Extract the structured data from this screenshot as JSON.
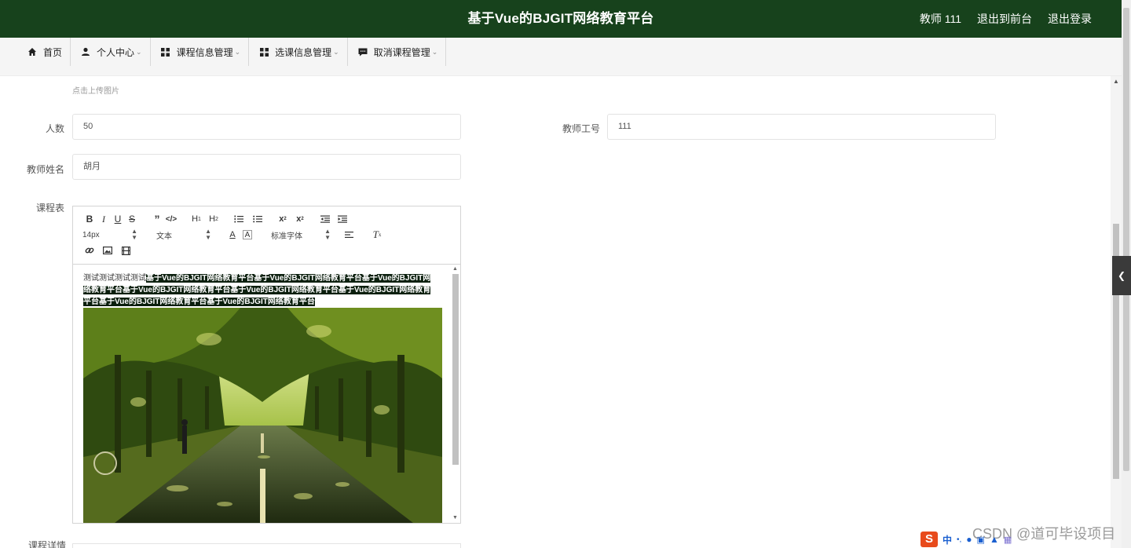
{
  "header": {
    "title": "基于Vue的BJGIT网络教育平台",
    "user_label": "教师 111",
    "back_front_label": "退出到前台",
    "logout_label": "退出登录"
  },
  "nav": {
    "items": [
      {
        "label": "首页",
        "icon": "home-icon",
        "has_dropdown": false
      },
      {
        "label": "个人中心",
        "icon": "user-icon",
        "has_dropdown": true
      },
      {
        "label": "课程信息管理",
        "icon": "grid-icon",
        "has_dropdown": true
      },
      {
        "label": "选课信息管理",
        "icon": "grid-icon",
        "has_dropdown": true
      },
      {
        "label": "取消课程管理",
        "icon": "chat-icon",
        "has_dropdown": true
      }
    ]
  },
  "form": {
    "upload_hint": "点击上传图片",
    "count_label": "人数",
    "count_value": "50",
    "teacher_id_label": "教师工号",
    "teacher_id_value": "111",
    "teacher_name_label": "教师姓名",
    "teacher_name_value": "胡月",
    "schedule_label": "课程表",
    "details_label": "课程详情"
  },
  "editor": {
    "font_size": "14px",
    "text_type": "文本",
    "font_family": "标准字体",
    "content_plain": "测试测试测试测试",
    "content_highlight": "基于Vue的BJGIT网络教育平台基于Vue的BJGIT网络教育平台基于Vue的BJGIT网络教育平台基于Vue的BJGIT网络教育平台基于Vue的BJGIT网络教育平台基于Vue的BJGIT网络教育平台基于Vue的BJGIT网络教育平台基于Vue的BJGIT网络教育平台",
    "image_alt": "tree-lined campus road photo"
  },
  "overlay": {
    "ime_logo": "S",
    "ime_lang": "中",
    "watermark": "CSDN @道可毕设项目"
  },
  "colors": {
    "header_bg": "#17421c",
    "nav_bg": "#f5f5f5",
    "highlight_bg": "#0b1f0e"
  }
}
